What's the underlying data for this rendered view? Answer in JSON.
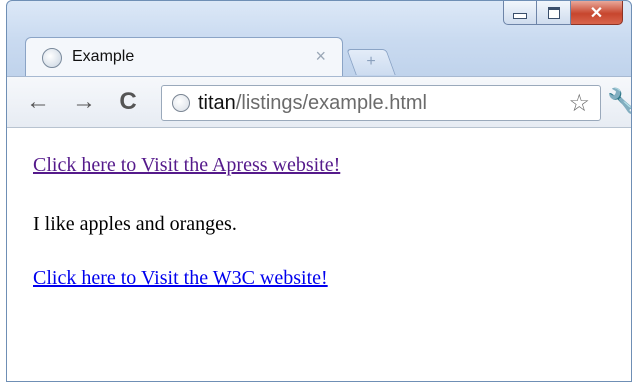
{
  "window": {
    "controls": {
      "minimize_icon": "minimize-icon",
      "maximize_icon": "maximize-icon",
      "close_label": "✕"
    }
  },
  "tab": {
    "title": "Example",
    "close_label": "×",
    "favicon": "globe-icon"
  },
  "new_tab": {
    "label": "+"
  },
  "toolbar": {
    "back_label": "←",
    "forward_label": "→",
    "reload_label": "C",
    "url_host": "titan",
    "url_path": "/listings/example.html",
    "star_label": "☆",
    "wrench_label": "🔧"
  },
  "page": {
    "link1": "Click here to Visit the Apress website!",
    "paragraph": "I like apples and oranges.",
    "link2": "Click here to Visit the W3C website!"
  },
  "colors": {
    "visited_link": "#551a8b",
    "link": "#0000ee",
    "frame": "#c9daf0"
  }
}
